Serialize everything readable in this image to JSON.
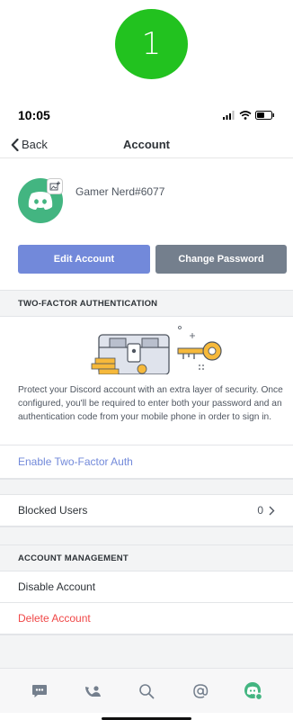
{
  "step_badge": "1",
  "status_bar": {
    "time": "10:05"
  },
  "nav": {
    "back_label": "Back",
    "title": "Account"
  },
  "profile": {
    "username": "Gamer Nerd#6077"
  },
  "buttons": {
    "edit_account": "Edit Account",
    "change_password": "Change Password"
  },
  "two_factor": {
    "header": "TWO-FACTOR AUTHENTICATION",
    "description": "Protect your Discord account with an extra layer of security. Once configured, you'll be required to enter both your password and an authentication code from your mobile phone in order to sign in.",
    "enable_link": "Enable Two-Factor Auth"
  },
  "blocked_users": {
    "label": "Blocked Users",
    "count": "0"
  },
  "account_management": {
    "header": "ACCOUNT MANAGEMENT",
    "disable": "Disable Account",
    "delete": "Delete Account"
  },
  "colors": {
    "blurple": "#7289da",
    "grey_button": "#747f8d",
    "green": "#43b581",
    "danger": "#f04747",
    "step_badge": "#22c21f"
  },
  "tab_bar": {
    "tabs": [
      {
        "icon": "chat-icon",
        "active": false
      },
      {
        "icon": "friends-icon",
        "active": false
      },
      {
        "icon": "search-icon",
        "active": false
      },
      {
        "icon": "mention-icon",
        "active": false
      },
      {
        "icon": "profile-icon",
        "active": true
      }
    ]
  }
}
